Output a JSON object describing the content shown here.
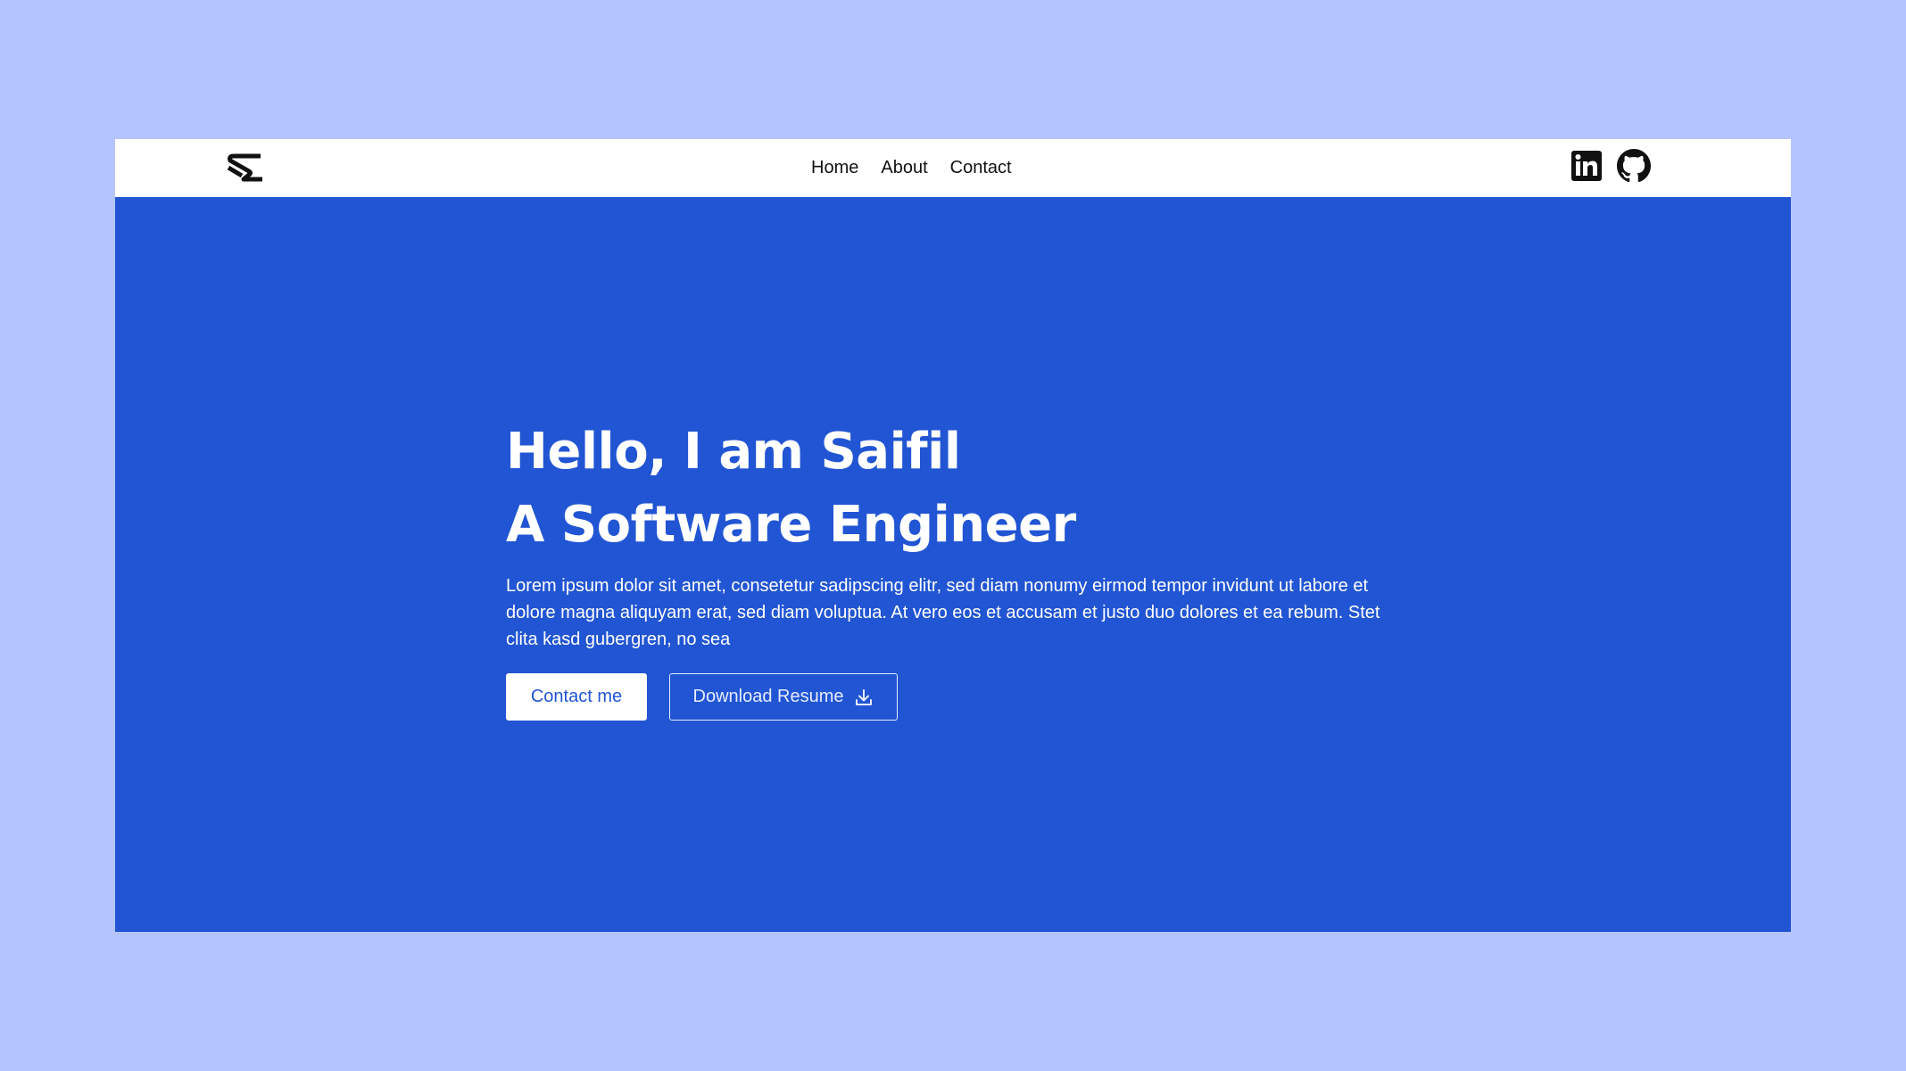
{
  "colors": {
    "page_background": "#b4c4fe",
    "hero_background": "#2155d3",
    "navbar_background": "#ffffff",
    "text_light": "#ffffff",
    "text_dark": "#111111"
  },
  "navbar": {
    "logo_icon": "sc-logo-icon",
    "links": [
      {
        "label": "Home"
      },
      {
        "label": "About"
      },
      {
        "label": "Contact"
      }
    ],
    "social_icons": [
      "linkedin-icon",
      "github-icon"
    ]
  },
  "hero": {
    "title_line1": "Hello, I am Saifil",
    "title_line2": "A Software Engineer",
    "description": "Lorem ipsum dolor sit amet, consetetur sadipscing elitr, sed diam nonumy eirmod tempor invidunt ut labore et dolore magna aliquyam erat, sed diam voluptua. At vero eos et accusam et justo duo dolores et ea rebum. Stet clita kasd gubergren, no sea",
    "primary_button": "Contact me",
    "secondary_button": "Download Resume",
    "secondary_button_icon": "download-icon"
  }
}
